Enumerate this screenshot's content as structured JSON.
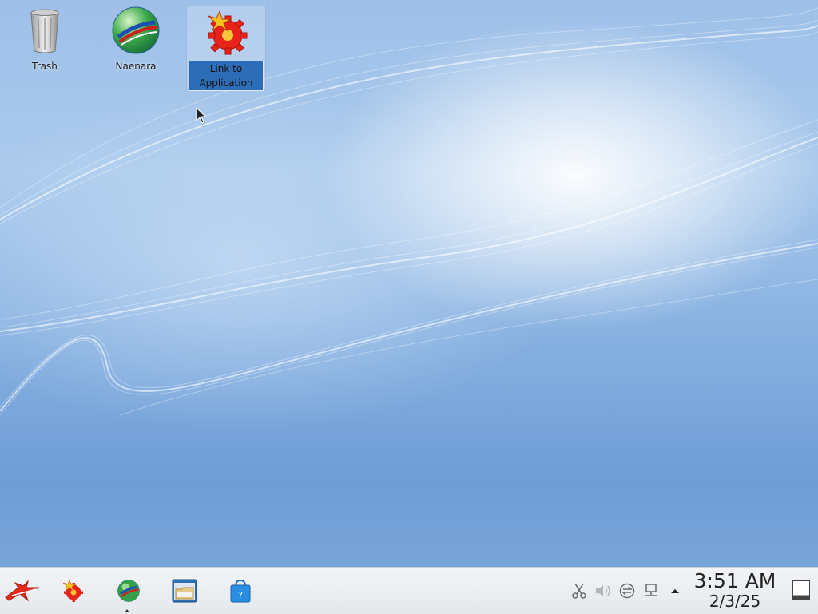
{
  "desktop": {
    "icons": [
      {
        "label": "Trash",
        "icon": "trash-icon"
      },
      {
        "label": "Naenara",
        "icon": "globe-browser-icon"
      },
      {
        "label": "Link to Application",
        "icon": "red-star-gear-icon",
        "selected": true
      }
    ]
  },
  "taskbar": {
    "launcher_icon": "red-star-launcher-icon",
    "apps": [
      {
        "name": "app-star-gear",
        "icon": "red-star-gear-icon"
      },
      {
        "name": "naenara-browser",
        "icon": "globe-browser-icon",
        "active": true
      },
      {
        "name": "file-manager",
        "icon": "file-manager-icon"
      },
      {
        "name": "software-store",
        "icon": "shopping-bag-icon"
      }
    ],
    "tray": [
      "clipboard-icon",
      "volume-icon",
      "update-icon",
      "network-icon",
      "expand-arrow-icon"
    ],
    "clock": {
      "time": "3:51 AM",
      "date": "2/3/25"
    },
    "show_desktop_icon": "show-desktop-icon"
  },
  "colors": {
    "selection": "#2d6db8",
    "panel": "#eceff2",
    "wallpaper": "#8cb4e2"
  }
}
